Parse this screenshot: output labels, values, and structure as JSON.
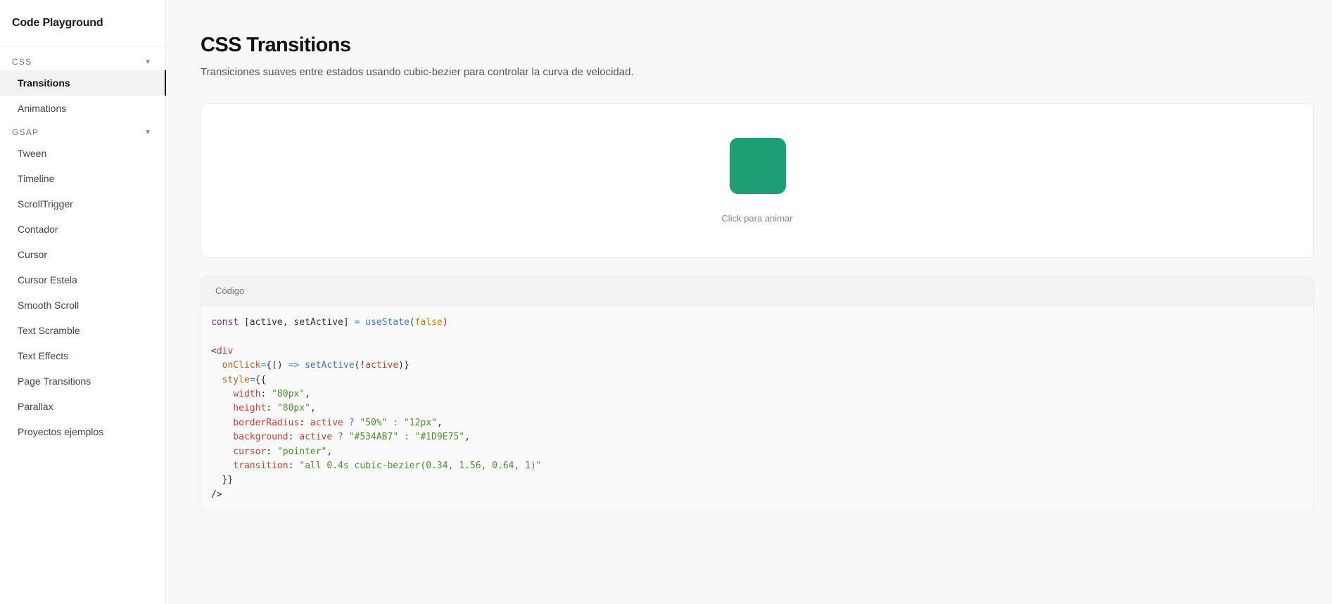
{
  "app": {
    "brand": "Code Playground"
  },
  "sidebar": {
    "groups": [
      {
        "label": "CSS",
        "chevron": "▼",
        "items": [
          {
            "label": "Transitions",
            "active": true
          },
          {
            "label": "Animations"
          }
        ]
      },
      {
        "label": "GSAP",
        "chevron": "▼",
        "items": [
          {
            "label": "Tween"
          },
          {
            "label": "Timeline"
          },
          {
            "label": "ScrollTrigger"
          },
          {
            "label": "Contador"
          },
          {
            "label": "Cursor"
          },
          {
            "label": "Cursor Estela"
          },
          {
            "label": "Smooth Scroll"
          },
          {
            "label": "Text Scramble"
          },
          {
            "label": "Text Effects"
          },
          {
            "label": "Page Transitions"
          },
          {
            "label": "Parallax"
          },
          {
            "label": "Proyectos ejemplos"
          }
        ]
      }
    ]
  },
  "page": {
    "title": "CSS Transitions",
    "subtitle": "Transiciones suaves entre estados usando cubic-bezier para controlar la curva de velocidad."
  },
  "preview": {
    "hint": "Click para animar",
    "box_color": "#1D9E75"
  },
  "code": {
    "header": "Código",
    "lines": [
      [
        [
          "kw",
          "const "
        ],
        [
          "plain",
          "[active, setActive] "
        ],
        [
          "op",
          "= "
        ],
        [
          "fn",
          "useState"
        ],
        [
          "plain",
          "("
        ],
        [
          "bool",
          "false"
        ],
        [
          "plain",
          ")"
        ]
      ],
      [],
      [
        [
          "plain",
          "<"
        ],
        [
          "tag",
          "div"
        ]
      ],
      [
        [
          "plain",
          "  "
        ],
        [
          "attr",
          "onClick"
        ],
        [
          "op",
          "="
        ],
        [
          "plain",
          "{() "
        ],
        [
          "op",
          "=> "
        ],
        [
          "fn",
          "setActive"
        ],
        [
          "plain",
          "(!"
        ],
        [
          "var",
          "active"
        ],
        [
          "plain",
          ")}"
        ]
      ],
      [
        [
          "plain",
          "  "
        ],
        [
          "attr",
          "style"
        ],
        [
          "op",
          "="
        ],
        [
          "plain",
          "{{"
        ]
      ],
      [
        [
          "plain",
          "    "
        ],
        [
          "prop",
          "width"
        ],
        [
          "plain",
          ": "
        ],
        [
          "str",
          "\"80px\""
        ],
        [
          "plain",
          ","
        ]
      ],
      [
        [
          "plain",
          "    "
        ],
        [
          "prop",
          "height"
        ],
        [
          "plain",
          ": "
        ],
        [
          "str",
          "\"80px\""
        ],
        [
          "plain",
          ","
        ]
      ],
      [
        [
          "plain",
          "    "
        ],
        [
          "prop",
          "borderRadius"
        ],
        [
          "plain",
          ": "
        ],
        [
          "var",
          "active "
        ],
        [
          "op",
          "? "
        ],
        [
          "str",
          "\"50%\" "
        ],
        [
          "op",
          ": "
        ],
        [
          "str",
          "\"12px\""
        ],
        [
          "plain",
          ","
        ]
      ],
      [
        [
          "plain",
          "    "
        ],
        [
          "prop",
          "background"
        ],
        [
          "plain",
          ": "
        ],
        [
          "var",
          "active "
        ],
        [
          "op",
          "? "
        ],
        [
          "str",
          "\"#534AB7\" "
        ],
        [
          "op",
          ": "
        ],
        [
          "str",
          "\"#1D9E75\""
        ],
        [
          "plain",
          ","
        ]
      ],
      [
        [
          "plain",
          "    "
        ],
        [
          "prop",
          "cursor"
        ],
        [
          "plain",
          ": "
        ],
        [
          "str",
          "\"pointer\""
        ],
        [
          "plain",
          ","
        ]
      ],
      [
        [
          "plain",
          "    "
        ],
        [
          "prop",
          "transition"
        ],
        [
          "plain",
          ": "
        ],
        [
          "str",
          "\"all 0.4s cubic-bezier(0.34, 1.56, 0.64, 1)\""
        ]
      ],
      [
        [
          "plain",
          "  }}"
        ]
      ],
      [
        [
          "plain",
          "/>"
        ]
      ]
    ]
  }
}
